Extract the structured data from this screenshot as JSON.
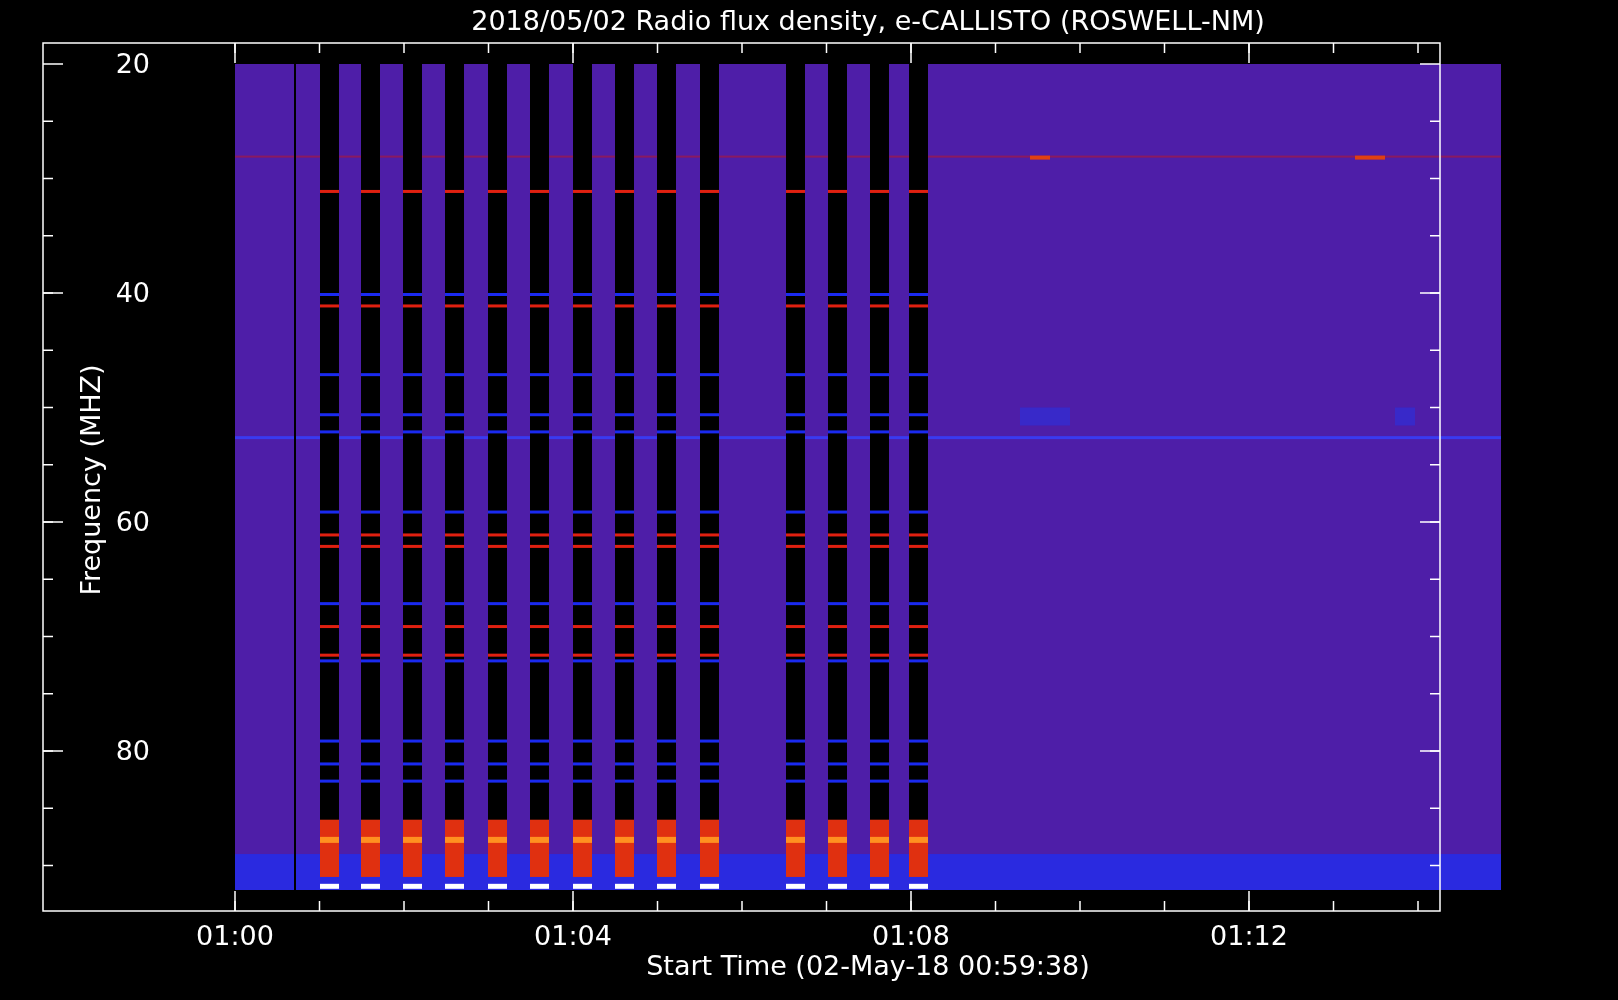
{
  "title": "2018/05/02  Radio flux density, e-CALLISTO (ROSWELL-NM)",
  "y_axis": {
    "label": "Frequency (MHZ)",
    "ticks": [
      "20",
      "40",
      "60",
      "80"
    ]
  },
  "x_axis": {
    "label": "Start Time (02-May-18 00:59:38)",
    "ticks": [
      "01:00",
      "01:04",
      "01:08",
      "01:12"
    ]
  }
}
